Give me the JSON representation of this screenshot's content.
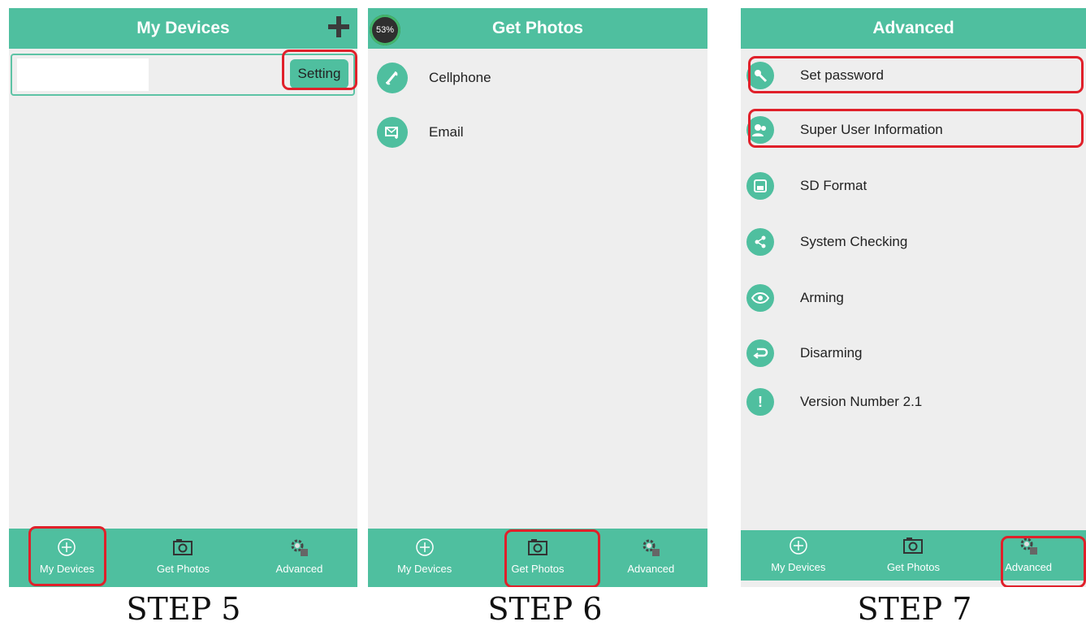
{
  "panels": [
    {
      "title": "My Devices",
      "setting_label": "Setting",
      "tabs": [
        "My Devices",
        "Get Photos",
        "Advanced"
      ]
    },
    {
      "title": "Get Photos",
      "progress": "53%",
      "items": [
        "Cellphone",
        "Email"
      ],
      "tabs": [
        "My Devices",
        "Get Photos",
        "Advanced"
      ]
    },
    {
      "title": "Advanced",
      "items": [
        "Set password",
        "Super User Information",
        "SD Format",
        "System Checking",
        "Arming",
        "Disarming",
        "Version Number 2.1"
      ],
      "tabs": [
        "My Devices",
        "Get Photos",
        "Advanced"
      ]
    }
  ],
  "steps": [
    "STEP 5",
    "STEP 6",
    "STEP 7"
  ],
  "colors": {
    "accent": "#4fbf9f",
    "highlight": "#e0202a",
    "background": "#eeeeee"
  }
}
